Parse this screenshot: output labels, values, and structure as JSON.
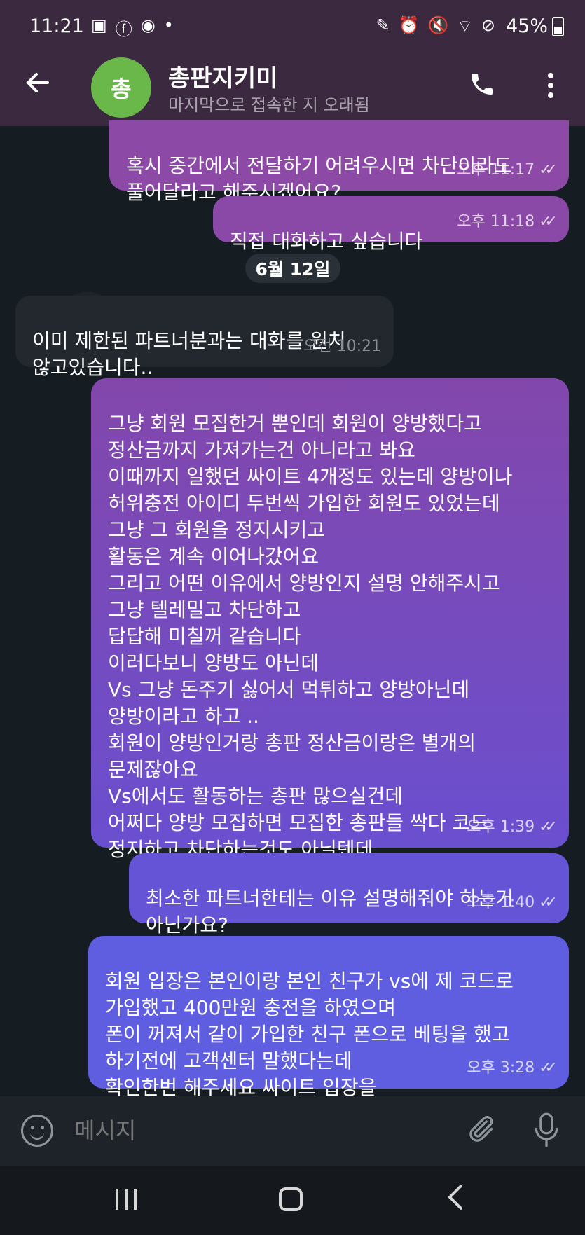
{
  "status_bar": {
    "time": "11:21",
    "battery": "45%",
    "left_icons": [
      "gallery-icon",
      "facebook-icon",
      "kakaotalk-icon",
      "dot-icon"
    ],
    "right_icons": [
      "edit-icon",
      "alarm-icon",
      "mute-icon",
      "wifi-icon",
      "dnd-icon"
    ]
  },
  "header": {
    "avatar_letter": "총",
    "avatar_color": "#6bb84a",
    "title": "총판지키미",
    "subtitle": "마지막으로 접속한 지 오래됨"
  },
  "date_separator": "6월 12일",
  "messages": [
    {
      "direction": "out",
      "text": "혹시 중간에서 전달하기 어려우시면 차단이라도\n풀어달라고 해주시겠어요?",
      "time": "오후 11:17",
      "read": true
    },
    {
      "direction": "out",
      "text": "직접 대화하고 싶습니다",
      "time": "오후 11:18",
      "read": true
    },
    {
      "direction": "in",
      "text": "이미 제한된 파트너분과는 대화를 원치\n않고있습니다..",
      "time": "오전 10:21"
    },
    {
      "direction": "out",
      "text": "그냥 회원 모집한거 뿐인데 회원이 양방했다고\n정산금까지 가져가는건 아니라고 봐요\n이때까지 일했던 싸이트 4개정도 있는데 양방이나\n허위충전 아이디 두번씩 가입한 회원도 있었는데\n그냥 그 회원을 정지시키고\n활동은 계속 이어나갔어요\n그리고 어떤 이유에서 양방인지  설명 안해주시고\n그냥 텔레밀고 차단하고\n답답해 미칠꺼 같습니다\n이러다보니 양방도 아닌데\nVs 그냥 돈주기 싫어서 먹튀하고  양방아닌데\n양방이라고 하고 ..\n회원이 양방인거랑 총판 정산금이랑은 별개의\n문제잖아요\nVs에서도 활동하는 총판 많으실건데\n어쩌다 양방 모집하면  모집한 총판들 싹다 코드\n정지하고  차단하는것도 아닐텐데",
      "time": "오후 1:39",
      "read": true
    },
    {
      "direction": "out",
      "text": "최소한 파트너한테는 이유 설명해줘야 하는거\n아닌가요?",
      "time": "오후 1:40",
      "read": true
    },
    {
      "direction": "out",
      "text": "회원 입장은 본인이랑 본인 친구가 vs에 제 코드로\n가입했고 400만원 충전을 하였으며\n 폰이 꺼져서 같이 가입한 친구 폰으로 베팅을 했고\n하기전에 고객센터 말했다는데\n 확인한번 해주세요 싸이트 입장을",
      "time": "오후 3:28",
      "read": true
    }
  ],
  "composer": {
    "placeholder": "메시지"
  },
  "colors": {
    "header_bg": "#3b2a3f",
    "incoming_bubble": "#22282e",
    "outgoing_gradient_top": "#8a47a8",
    "outgoing_gradient_bottom": "#5f5fe0"
  }
}
